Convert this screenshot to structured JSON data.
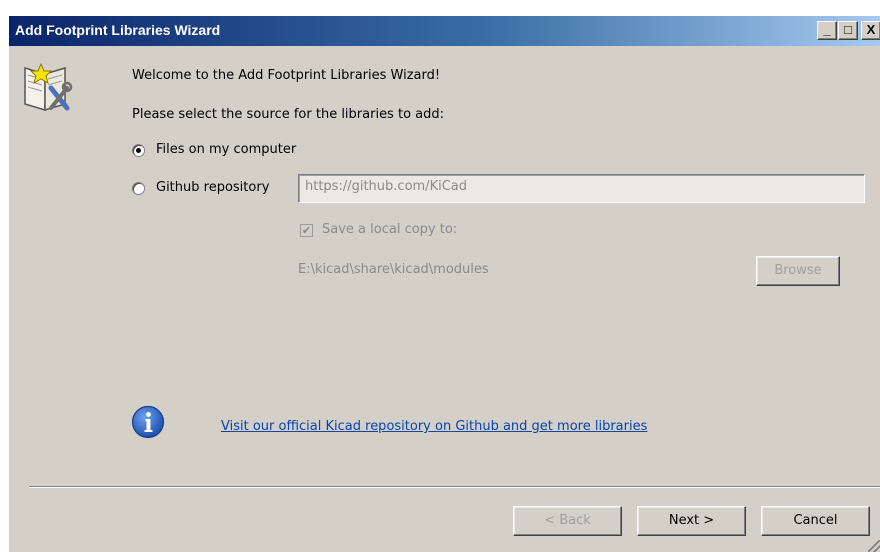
{
  "window": {
    "title": "Add Footprint Libraries Wizard",
    "min_glyph": "_",
    "max_glyph": "□",
    "close_glyph": "X"
  },
  "wizard": {
    "welcome_text": "Welcome to the Add Footprint Libraries Wizard!",
    "prompt_text": "Please select the source for the libraries to add:",
    "source_options": [
      {
        "label": "Files on my computer",
        "checked": true
      },
      {
        "label": "Github repository",
        "checked": false
      }
    ],
    "github_url_value": "https://github.com/KiCad",
    "save_local_copy_label": "Save a local copy to:",
    "save_local_copy_checked": true,
    "local_path": "E:\\kicad\\share\\kicad\\modules",
    "browse_label": "Browse",
    "info_link_text": "Visit our official Kicad repository on Github and get more libraries"
  },
  "footer": {
    "back_label": "< Back",
    "next_label": "Next >",
    "cancel_label": "Cancel"
  },
  "icons": {
    "wizard": "wizard-book-icon",
    "info": "info-icon"
  },
  "colors": {
    "titlebar_start": "#0a246a",
    "dialog_bg": "#d4d0c8",
    "link": "#0645ad"
  }
}
